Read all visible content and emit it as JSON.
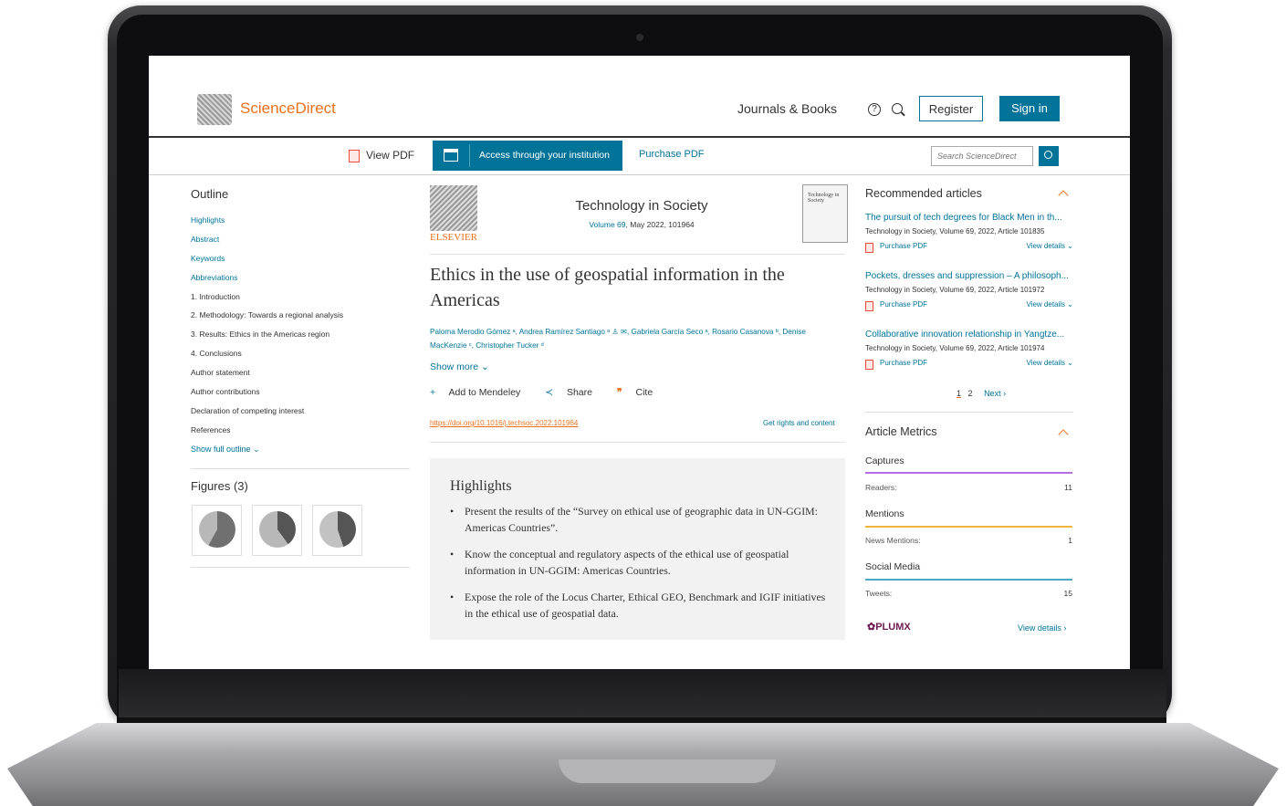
{
  "header": {
    "brand": "ScienceDirect",
    "journals_books": "Journals & Books",
    "help_icon_glyph": "?",
    "register": "Register",
    "sign_in": "Sign in"
  },
  "toolbar": {
    "view_pdf": "View PDF",
    "access": "Access through your institution",
    "purchase_pdf": "Purchase PDF",
    "search_placeholder": "Search ScienceDirect"
  },
  "outline": {
    "title": "Outline",
    "items": [
      {
        "label": "Highlights",
        "link": true
      },
      {
        "label": "Abstract",
        "link": true
      },
      {
        "label": "Keywords",
        "link": true
      },
      {
        "label": "Abbreviations",
        "link": true
      },
      {
        "label": "1. Introduction",
        "link": false
      },
      {
        "label": "2. Methodology: Towards a regional analysis",
        "link": false
      },
      {
        "label": "3. Results: Ethics in the Americas region",
        "link": false
      },
      {
        "label": "4. Conclusions",
        "link": false
      },
      {
        "label": "Author statement",
        "link": false
      },
      {
        "label": "Author contributions",
        "link": false
      },
      {
        "label": "Declaration of competing interest",
        "link": false
      },
      {
        "label": "References",
        "link": false
      }
    ],
    "show_full": "Show full outline"
  },
  "figures": {
    "title": "Figures (3)"
  },
  "article": {
    "publisher": "ELSEVIER",
    "journal": "Technology in Society",
    "volume_link": "Volume 69",
    "volume_rest": ", May 2022, 101964",
    "cover_text": "Technology in Society",
    "title": "Ethics in the use of geospatial information in the Americas",
    "authors": "Paloma Merodio Gómez ᵃ, Andrea Ramírez Santiago ᵃ ♙ ✉, Gabriela García Seco ᵃ, Rosario Casanova ᵇ, Denise MacKenzie ᶜ, Christopher Tucker ᵈ",
    "show_more": "Show more",
    "add_mendeley": "Add to Mendeley",
    "share": "Share",
    "cite": "Cite",
    "doi": "https://doi.org/10.1016/j.techsoc.2022.101964",
    "rights": "Get rights and content"
  },
  "highlights": {
    "title": "Highlights",
    "items": [
      "Present the results of the “Survey on ethical use of geographic data in UN-GGIM: Americas Countries”.",
      "Know the conceptual and regulatory aspects of the ethical use of geospatial information in UN-GGIM: Americas Countries.",
      "Expose the role of the Locus Charter, Ethical GEO, Benchmark and IGIF initiatives in the ethical use of geospatial data."
    ]
  },
  "recommended": {
    "title": "Recommended articles",
    "purchase_label": "Purchase PDF",
    "details_label": "View details",
    "items": [
      {
        "title": "The pursuit of tech degrees for Black Men in th...",
        "meta": "Technology in Society, Volume 69, 2022, Article 101835"
      },
      {
        "title": "Pockets, dresses and suppression – A philosoph...",
        "meta": "Technology in Society, Volume 69, 2022, Article 101972"
      },
      {
        "title": "Collaborative innovation relationship in Yangtze...",
        "meta": "Technology in Society, Volume 69, 2022, Article 101974"
      }
    ],
    "pager": {
      "page1": "1",
      "page2": "2",
      "next": "Next"
    }
  },
  "metrics": {
    "title": "Article Metrics",
    "captures": "Captures",
    "readers_label": "Readers:",
    "readers_value": "11",
    "mentions": "Mentions",
    "news_label": "News Mentions:",
    "news_value": "1",
    "social": "Social Media",
    "tweets_label": "Tweets:",
    "tweets_value": "15",
    "plumx": "PLUMX",
    "view_details": "View details"
  },
  "colors": {
    "brand_orange": "#e9711c",
    "link_blue": "#007398",
    "captures_line": "#b470e0",
    "mentions_line": "#f0b53a",
    "social_line": "#4aa9c9"
  }
}
